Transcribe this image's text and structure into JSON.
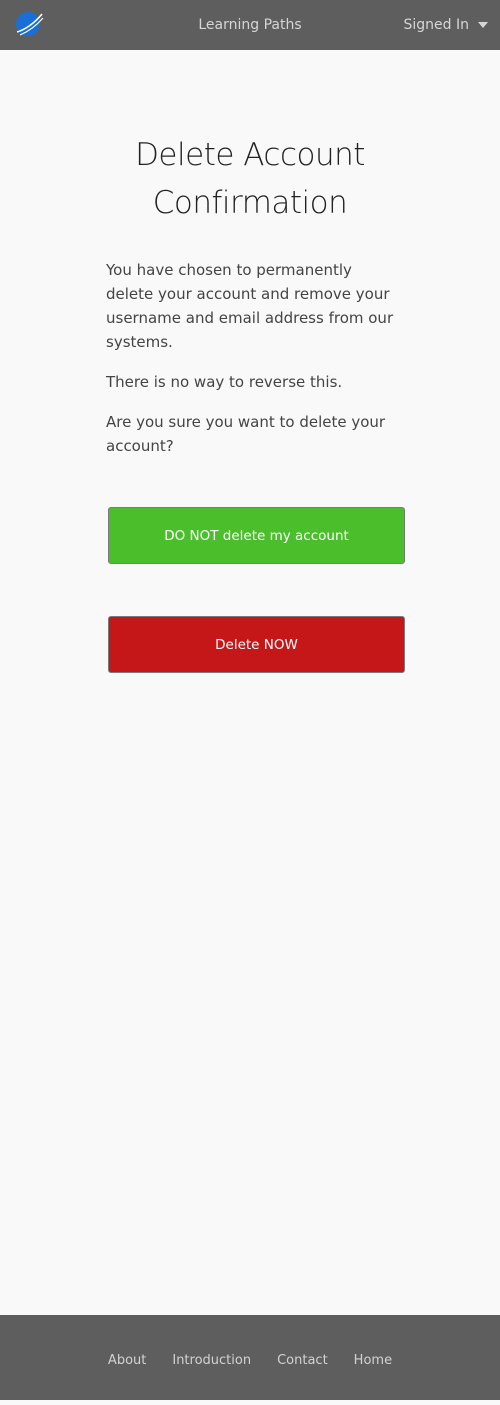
{
  "header": {
    "title": "Learning Paths",
    "account_label": "Signed In",
    "logo_icon": "globe-swoosh-icon"
  },
  "main": {
    "heading_line1": "Delete Account",
    "heading_line2": "Confirmation",
    "paragraphs": [
      "You have chosen to permanently delete your account and remove your username and email address from our systems.",
      "There is no way to reverse this.",
      "Are you sure you want to delete your account?"
    ],
    "keep_button_label": "DO NOT delete my account",
    "delete_button_label": "Delete NOW"
  },
  "footer": {
    "links": [
      "About",
      "Introduction",
      "Contact",
      "Home"
    ]
  },
  "colors": {
    "topbar": "#5e5e5e",
    "keep_button": "#4bbf2b",
    "delete_button": "#c51717",
    "logo_blue": "#1a6fd6"
  }
}
